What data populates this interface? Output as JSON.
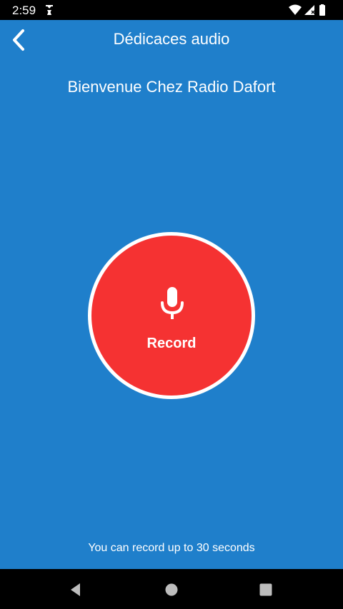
{
  "status_bar": {
    "time": "2:59",
    "icons": [
      "notification-icon",
      "wifi-icon",
      "signal-icon",
      "battery-icon"
    ]
  },
  "app_bar": {
    "title": "Dédicaces audio",
    "back_icon": "chevron-left-icon"
  },
  "main": {
    "welcome_text": "Bienvenue Chez Radio Dafort",
    "record_label": "Record",
    "record_icon": "microphone-icon",
    "hint": "You can record up to 30 seconds"
  },
  "nav_bar": {
    "icons": [
      "back-triangle-icon",
      "home-circle-icon",
      "recents-square-icon"
    ]
  },
  "colors": {
    "background": "#1f7fcb",
    "record_button": "#f53232",
    "record_ring": "#ffffff"
  }
}
